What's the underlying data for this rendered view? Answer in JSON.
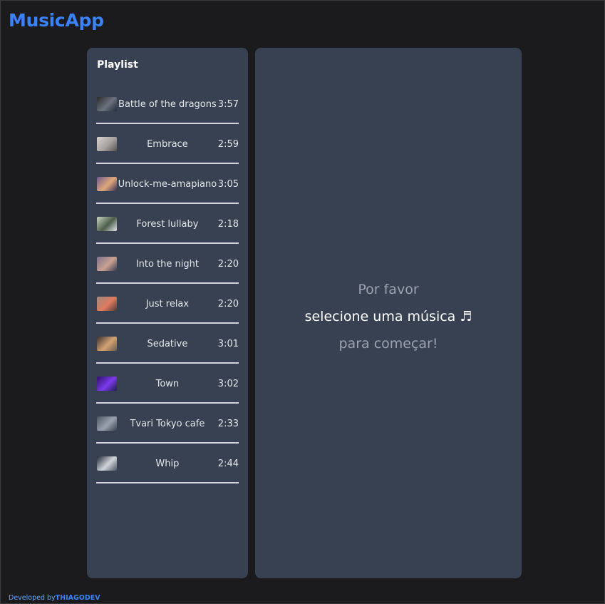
{
  "app": {
    "title": "MusicApp"
  },
  "playlist": {
    "title": "Playlist",
    "tracks": [
      {
        "name": "Battle of the dragons",
        "duration": "3:57",
        "thumb_colors": [
          "#2a2a2a",
          "#6b7280",
          "#1f2937"
        ]
      },
      {
        "name": "Embrace",
        "duration": "2:59",
        "thumb_colors": [
          "#d6d3d1",
          "#a8a29e",
          "#57534e"
        ]
      },
      {
        "name": "Unlock-me-amapiano",
        "duration": "3:05",
        "thumb_colors": [
          "#6d5a8c",
          "#e0a87a",
          "#3b2f55"
        ]
      },
      {
        "name": "Forest lullaby",
        "duration": "2:18",
        "thumb_colors": [
          "#cbd5c0",
          "#4b5e4a",
          "#e5e7eb"
        ]
      },
      {
        "name": "Into the night",
        "duration": "2:20",
        "thumb_colors": [
          "#7c6f8a",
          "#c9a390",
          "#3f3a4f"
        ]
      },
      {
        "name": "Just relax",
        "duration": "2:20",
        "thumb_colors": [
          "#a1887f",
          "#e07a5f",
          "#4a3b37"
        ]
      },
      {
        "name": "Sedative",
        "duration": "3:01",
        "thumb_colors": [
          "#3b3030",
          "#d4a373",
          "#6b5b4e"
        ]
      },
      {
        "name": "Town",
        "duration": "3:02",
        "thumb_colors": [
          "#2e1065",
          "#7c3aed",
          "#1e1b4b"
        ]
      },
      {
        "name": "Tvari Tokyo cafe",
        "duration": "2:33",
        "thumb_colors": [
          "#4b5563",
          "#9ca3af",
          "#374151"
        ]
      },
      {
        "name": "Whip",
        "duration": "2:44",
        "thumb_colors": [
          "#1f2937",
          "#d1d5db",
          "#4b5563"
        ]
      }
    ]
  },
  "player": {
    "prompt_line1": "Por favor",
    "prompt_line2": "selecione uma música ♬",
    "prompt_line3": "para começar!"
  },
  "footer": {
    "prefix": "Developed by",
    "brand_part1": "THIAGO",
    "brand_part2": "DEV"
  },
  "colors": {
    "accent": "#3b82f6",
    "panel_bg": "#374151",
    "page_bg": "#1b1b1d"
  }
}
